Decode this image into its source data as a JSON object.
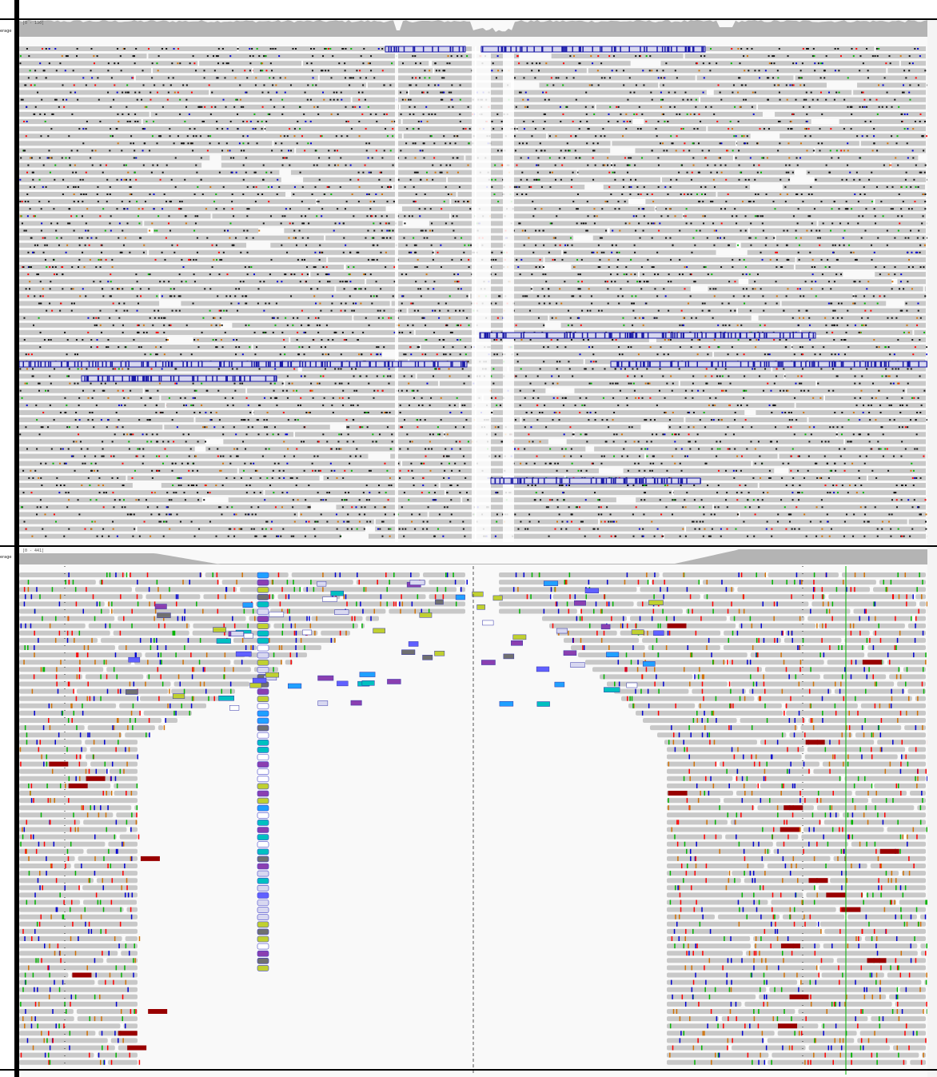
{
  "tracks": [
    {
      "name": "top-alignment-panel",
      "coverage_label": "erage",
      "range_label": "[0 - 130]",
      "colors": {
        "read": "#c8c8c8",
        "coverage": "#b4b4b4",
        "insertion": "#1a1aa8"
      }
    },
    {
      "name": "bottom-alignment-panel",
      "coverage_label": "erage",
      "range_label": "[0 - 441]",
      "colors": {
        "read": "#c8c8c8",
        "coverage": "#b4b4b4",
        "softclip_dark": "#990000"
      }
    }
  ],
  "colors": {
    "background": "#f9f9f9",
    "divider": "#000000",
    "mismatch_A": "#00b400",
    "mismatch_C": "#0000d0",
    "mismatch_G": "#d17105",
    "mismatch_T": "#ff0000",
    "center_line": "#555555"
  }
}
